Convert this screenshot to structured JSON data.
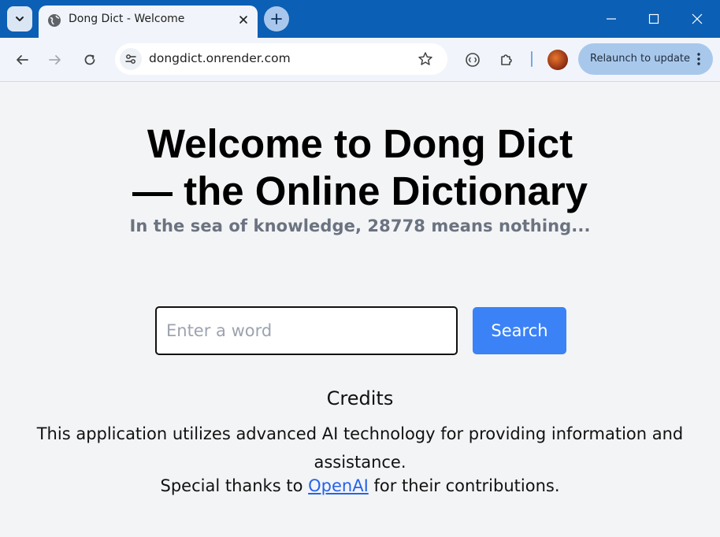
{
  "browser": {
    "tab_title": "Dong Dict - Welcome",
    "url": "dongdict.onrender.com",
    "relaunch_label": "Relaunch to update",
    "colors": {
      "frame": "#0b5fb4",
      "toolbar": "#f1f5fb",
      "relaunch_bg": "#a8c8eb"
    }
  },
  "page": {
    "title_line1": "Welcome to Dong Dict",
    "title_line2": "— the Online Dictionary",
    "subtitle": "In the sea of knowledge, 28778 means nothing...",
    "search": {
      "placeholder": "Enter a word",
      "value": "",
      "button_label": "Search"
    },
    "credits": {
      "title": "Credits",
      "text": "This application utilizes advanced AI technology for providing information and assistance.",
      "thanks_prefix": "Special thanks to",
      "thanks_link": "OpenAI",
      "thanks_suffix": "for their contributions."
    },
    "colors": {
      "accent": "#3b82f6",
      "subtitle": "#6b7280",
      "background": "#f3f4f6",
      "link": "#2563eb"
    }
  }
}
